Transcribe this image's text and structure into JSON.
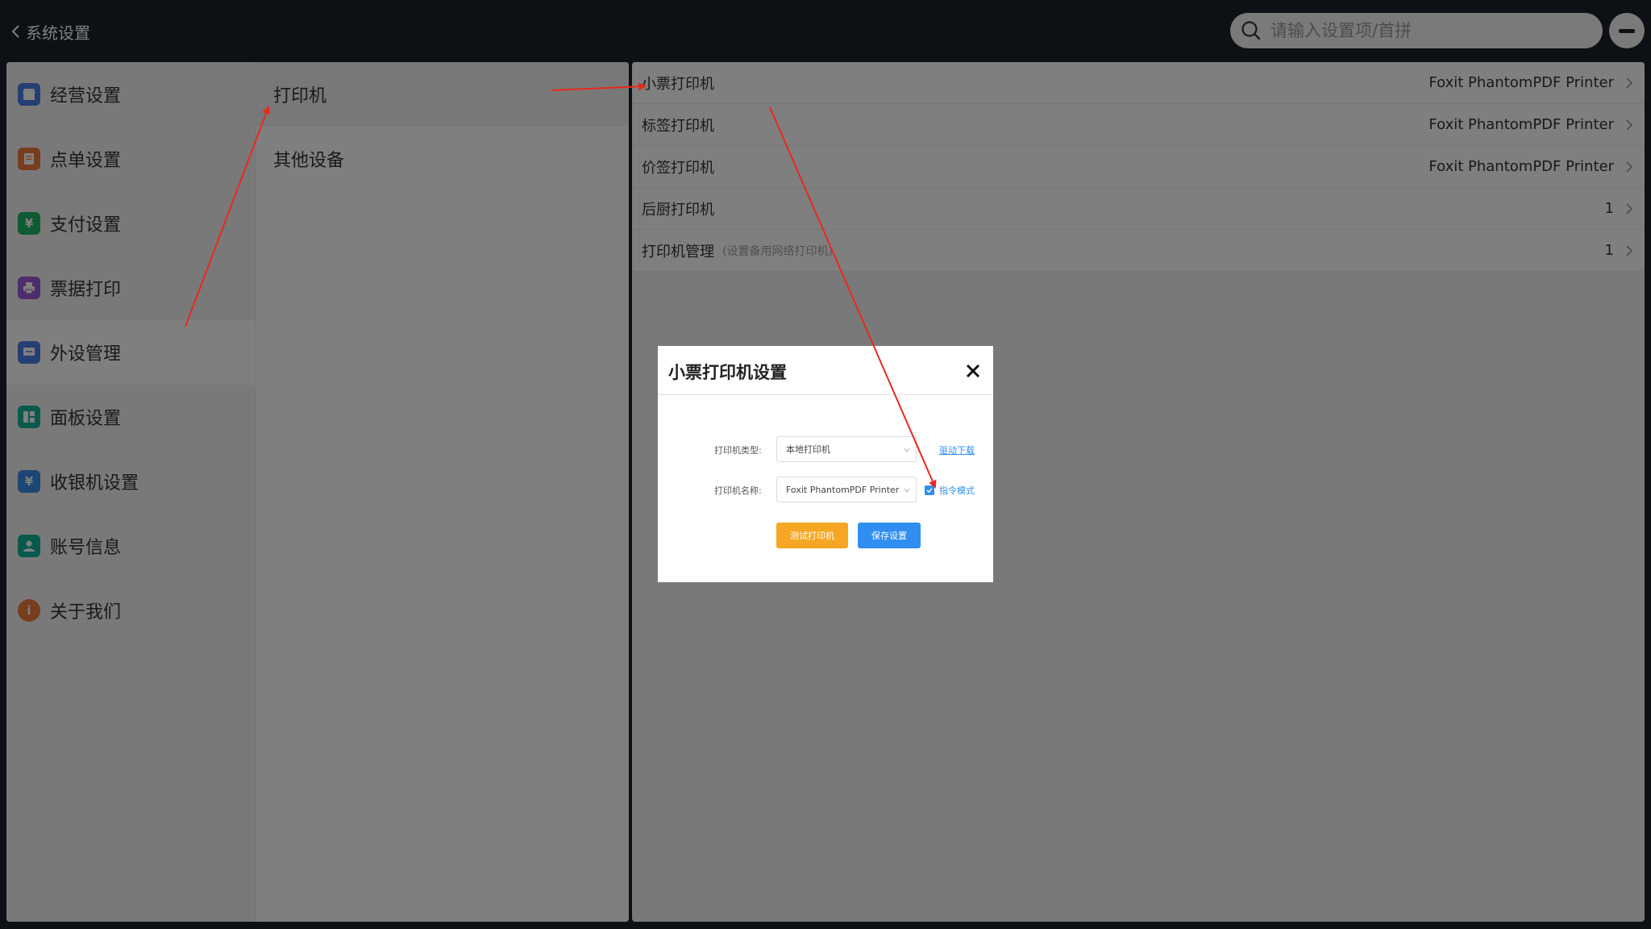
{
  "topbar": {
    "back_label": "系统设置",
    "search_placeholder": "请输入设置项/首拼"
  },
  "sidebar": {
    "items": [
      {
        "label": "经营设置",
        "icon": "store-icon",
        "color": "#4a7de8"
      },
      {
        "label": "点单设置",
        "icon": "order-icon",
        "color": "#f07b3a"
      },
      {
        "label": "支付设置",
        "icon": "payment-icon",
        "color": "#1fb564",
        "glyph": "¥"
      },
      {
        "label": "票据打印",
        "icon": "printer-icon",
        "color": "#9a5bd6"
      },
      {
        "label": "外设管理",
        "icon": "device-icon",
        "color": "#4a7de8"
      },
      {
        "label": "面板设置",
        "icon": "panel-icon",
        "color": "#14b39a"
      },
      {
        "label": "收银机设置",
        "icon": "cashier-icon",
        "color": "#3a8ee6",
        "glyph": "¥"
      },
      {
        "label": "账号信息",
        "icon": "account-icon",
        "color": "#14b39a"
      },
      {
        "label": "关于我们",
        "icon": "info-icon",
        "color": "#f07b3a",
        "glyph": "i"
      }
    ],
    "active_index": 4
  },
  "subnav": {
    "items": [
      "打印机",
      "其他设备"
    ],
    "active_index": 0
  },
  "printers": [
    {
      "label": "小票打印机",
      "value": "Foxit PhantomPDF Printer",
      "note": ""
    },
    {
      "label": "标签打印机",
      "value": "Foxit PhantomPDF Printer",
      "note": ""
    },
    {
      "label": "价签打印机",
      "value": "Foxit PhantomPDF Printer",
      "note": ""
    },
    {
      "label": "后厨打印机",
      "value": "1",
      "note": ""
    },
    {
      "label": "打印机管理",
      "value": "1",
      "note": "(设置备用网络打印机)"
    }
  ],
  "dialog": {
    "title": "小票打印机设置",
    "type_label": "打印机类型:",
    "type_value": "本地打印机",
    "driver_link": "驱动下载",
    "name_label": "打印机名称:",
    "name_value": "Foxit PhantomPDF Printer",
    "command_mode_label": "指令模式",
    "command_mode_checked": true,
    "test_button": "测试打印机",
    "save_button": "保存设置"
  },
  "colors": {
    "accent_blue": "#2f8ef0",
    "accent_orange": "#f5a623",
    "annotation_red": "#e8291c",
    "topbar_bg": "#1b2029"
  }
}
